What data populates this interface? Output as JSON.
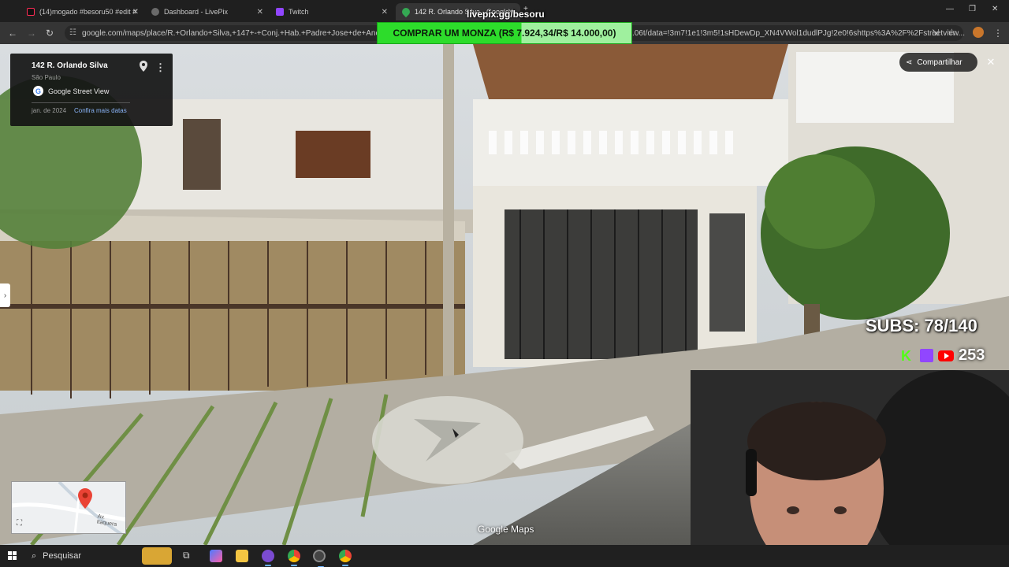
{
  "tabs": [
    {
      "label": "(14)mogado #besoru50 #edit #",
      "icon": "tiktok-icon"
    },
    {
      "label": "Dashboard - LivePix",
      "icon": "livepix-icon"
    },
    {
      "label": "Twitch",
      "icon": "twitch-icon"
    },
    {
      "label": "142 R. Orlando Silva - Google",
      "icon": "maps-pin-icon"
    }
  ],
  "address_bar": {
    "url_left": "google.com/maps/place/R.+Orlando+Silva,+147+-+Conj.+Hab.+Padre+Jose+de+Anchieta",
    "url_right": ".06t/data=!3m7!1e1!3m5!1sHDewDp_XN4VWol1dudlPJg!2e0!6shttps%3A%2F%2Fstreetview..."
  },
  "overlay": {
    "livepix_handle": "livepix.gg/besoru",
    "donation_banner": "COMPRAR UM MONZA (R$ 7.924,34/R$ 14.000,00)",
    "donation_progress": 0.566,
    "subs": "SUBS: 78/140",
    "viewers": "253"
  },
  "street_view": {
    "place_title": "142 R. Orlando Silva",
    "city": "São Paulo",
    "provider": "Google Street View",
    "capture_date": "jan. de 2024",
    "more_dates_link": "Confira mais datas",
    "share_label": "Compartilhar",
    "watermark": "Google Maps",
    "minimap_street": "Av. Itaquera"
  },
  "taskbar": {
    "search_placeholder": "Pesquisar"
  },
  "colors": {
    "donation_green": "#2ddc2b",
    "link_blue": "#8ab4f8",
    "kick_green": "#53fc18",
    "twitch_purple": "#9146ff",
    "youtube_red": "#ff0000"
  }
}
